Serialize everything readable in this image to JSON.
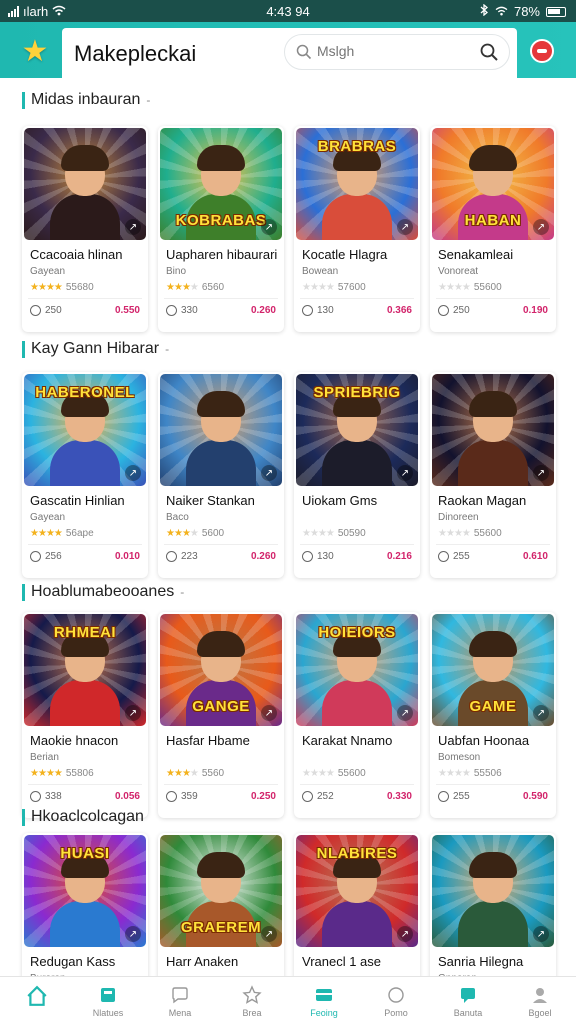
{
  "status_bar": {
    "carrier": "ılarh",
    "time": "4:43 94",
    "battery": "78%"
  },
  "header": {
    "app_title": "Makepleckai",
    "search_placeholder": "Mslgh",
    "accent_color": "#1fb8b0",
    "logo_icon": "star-icon",
    "record_icon": "record-icon"
  },
  "sections": [
    {
      "title": "Midas inbauran",
      "cards": [
        {
          "title": "Ccacoaia hlinan",
          "subtitle": "Gayean",
          "rating": 4,
          "reviews": "55680",
          "views": "250",
          "price": "0.550",
          "banner": "",
          "palette": [
            "#3a2a4a",
            "#c58a3b",
            "#2b1a1a"
          ]
        },
        {
          "title": "Uapharen hibaurari",
          "subtitle": "Bino",
          "rating": 3,
          "reviews": "6560",
          "views": "330",
          "price": "0.260",
          "banner": "KOBRABAS",
          "palette": [
            "#1fae8e",
            "#f3c24a",
            "#3e7f2a"
          ]
        },
        {
          "title": "Kocatle Hlagra",
          "subtitle": "Bowean",
          "rating": 0,
          "reviews": "57600",
          "views": "130",
          "price": "0.366",
          "banner": "BRABRAS",
          "palette": [
            "#2b6fd6",
            "#e9a05c",
            "#d94d3a"
          ]
        },
        {
          "title": "Senakamleai",
          "subtitle": "Vonoreat",
          "rating": 0,
          "reviews": "55600",
          "views": "250",
          "price": "0.190",
          "banner": "HABAN",
          "palette": [
            "#f07a2a",
            "#f2c14a",
            "#c43a8a"
          ]
        }
      ]
    },
    {
      "title": "Kay Gann Hibarar",
      "cards": [
        {
          "title": "Gascatin Hinlian",
          "subtitle": "Gayean",
          "rating": 4,
          "reviews": "56ape",
          "views": "256",
          "price": "0.010",
          "banner": "HABERONEL",
          "palette": [
            "#2bb3e0",
            "#f2b34a",
            "#3a52b8"
          ]
        },
        {
          "title": "Naiker Stankan",
          "subtitle": "Baco",
          "rating": 3,
          "reviews": "5600",
          "views": "223",
          "price": "0.260",
          "banner": "",
          "palette": [
            "#3f86c7",
            "#d9a06a",
            "#23406e"
          ]
        },
        {
          "title": "Uiokam Gms",
          "subtitle": "",
          "rating": 0,
          "reviews": "50590",
          "views": "130",
          "price": "0.216",
          "banner": "SPRIEBRIG",
          "palette": [
            "#1c2a5a",
            "#a86a4a",
            "#1c1c2a"
          ]
        },
        {
          "title": "Raokan Magan",
          "subtitle": "Dinoreen",
          "rating": 0,
          "reviews": "55600",
          "views": "255",
          "price": "0.610",
          "banner": "",
          "palette": [
            "#12122e",
            "#b9774c",
            "#5a2a1a"
          ]
        }
      ]
    },
    {
      "title": "Hoablumabeooanes",
      "cards": [
        {
          "title": "Maokie hnacon",
          "subtitle": "Berian",
          "rating": 4,
          "reviews": "55806",
          "views": "338",
          "price": "0.056",
          "banner": "RHMEAI",
          "palette": [
            "#151a4a",
            "#c9774a",
            "#d0282a"
          ]
        },
        {
          "title": "Hasfar Hbame",
          "subtitle": "",
          "rating": 3,
          "reviews": "5560",
          "views": "359",
          "price": "0.250",
          "banner": "GANGE",
          "palette": [
            "#e85a1a",
            "#b97a4a",
            "#6a2a8a"
          ]
        },
        {
          "title": "Karakat Nnamo",
          "subtitle": "",
          "rating": 0,
          "reviews": "55600",
          "views": "252",
          "price": "0.330",
          "banner": "HOIEIORS",
          "palette": [
            "#2aa6d0",
            "#e2a06a",
            "#d03a5a"
          ]
        },
        {
          "title": "Uabfan Hoonaa",
          "subtitle": "Bomeson",
          "rating": 0,
          "reviews": "55506",
          "views": "255",
          "price": "0.590",
          "banner": "GAME",
          "palette": [
            "#30b8e0",
            "#c9935a",
            "#6a4a2a"
          ]
        }
      ]
    },
    {
      "title": "Hkoaclcolcagan",
      "cards": [
        {
          "title": "Redugan Kass",
          "subtitle": "Buroran",
          "rating": 0,
          "reviews": "",
          "views": "",
          "price": "",
          "banner": "HUASI",
          "palette": [
            "#8a2ad0",
            "#e2502a",
            "#2a7ad0"
          ]
        },
        {
          "title": "Harr Anaken",
          "subtitle": "",
          "rating": 0,
          "reviews": "",
          "views": "",
          "price": "",
          "banner": "GRAEREM",
          "palette": [
            "#2f8a3a",
            "#eef0f0",
            "#a8582a"
          ]
        },
        {
          "title": "Vranecl 1 ase",
          "subtitle": "",
          "rating": 0,
          "reviews": "",
          "views": "",
          "price": "",
          "banner": "NLABIRES",
          "palette": [
            "#d02a2a",
            "#b47a5a",
            "#5a2a8a"
          ]
        },
        {
          "title": "Sanria Hilegna",
          "subtitle": "Gnnoran",
          "rating": 0,
          "reviews": "",
          "views": "",
          "price": "",
          "banner": "",
          "palette": [
            "#1a9ac0",
            "#e2a96a",
            "#2a5a3a"
          ]
        }
      ]
    }
  ],
  "bottom_nav": [
    {
      "label": "",
      "icon": "home-icon",
      "active": true
    },
    {
      "label": "Nlatues",
      "icon": "grid-icon",
      "active": false
    },
    {
      "label": "Mena",
      "icon": "chat-icon",
      "active": false
    },
    {
      "label": "Brea",
      "icon": "star-outline-icon",
      "active": false
    },
    {
      "label": "Feoing",
      "icon": "box-icon",
      "active": true
    },
    {
      "label": "Pomo",
      "icon": "bubble-icon",
      "active": false
    },
    {
      "label": "Banuta",
      "icon": "message-icon",
      "active": false
    },
    {
      "label": "Bgoel",
      "icon": "profile-icon",
      "active": false
    }
  ]
}
